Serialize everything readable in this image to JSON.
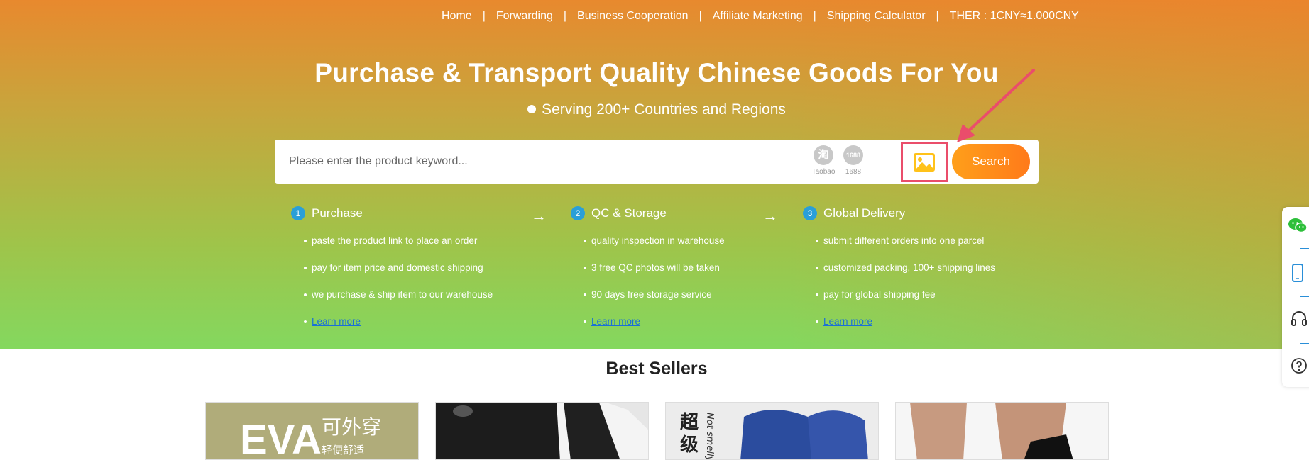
{
  "nav": {
    "items": [
      "Home",
      "Forwarding",
      "Business Cooperation",
      "Affiliate Marketing",
      "Shipping Calculator",
      "THER : 1CNY≈1.000CNY"
    ]
  },
  "hero": {
    "title": "Purchase & Transport Quality Chinese Goods For You",
    "subtitle": "Serving 200+ Countries and Regions"
  },
  "search": {
    "placeholder": "Please enter the product keyword...",
    "platforms": [
      {
        "icon_text": "淘",
        "label": "Taobao"
      },
      {
        "icon_text": "1688",
        "label": "1688"
      }
    ],
    "button_label": "Search"
  },
  "steps": [
    {
      "num": "1",
      "title": "Purchase",
      "items": [
        "paste the product link to place an order",
        "pay for item price and domestic shipping",
        "we purchase & ship item to our warehouse"
      ],
      "learn_more": "Learn more"
    },
    {
      "num": "2",
      "title": "QC & Storage",
      "items": [
        "quality inspection in warehouse",
        "3 free QC photos will be taken",
        "90 days free storage service"
      ],
      "learn_more": "Learn more"
    },
    {
      "num": "3",
      "title": "Global Delivery",
      "items": [
        "submit different orders into one parcel",
        "customized packing, 100+ shipping lines",
        "pay for global shipping fee"
      ],
      "learn_more": "Learn more"
    }
  ],
  "step_arrow": "→",
  "best_sellers": {
    "title": "Best Sellers",
    "product1_text": {
      "brand": "EVA",
      "tag1": "可外穿",
      "tag2": "轻便舒适"
    },
    "product3_text": {
      "tag1": "超",
      "tag2": "级",
      "tag3": "Not smelly"
    }
  },
  "colors": {
    "hero_top": "#e8892e",
    "hero_bottom": "#84d85f",
    "search_button": "#ff8c1a",
    "highlight_box": "#ea4d6b",
    "step_number": "#2a9fd8",
    "link": "#1a6fd8"
  },
  "side_tools": [
    "wechat-icon",
    "phone-icon",
    "headset-icon",
    "help-icon"
  ]
}
